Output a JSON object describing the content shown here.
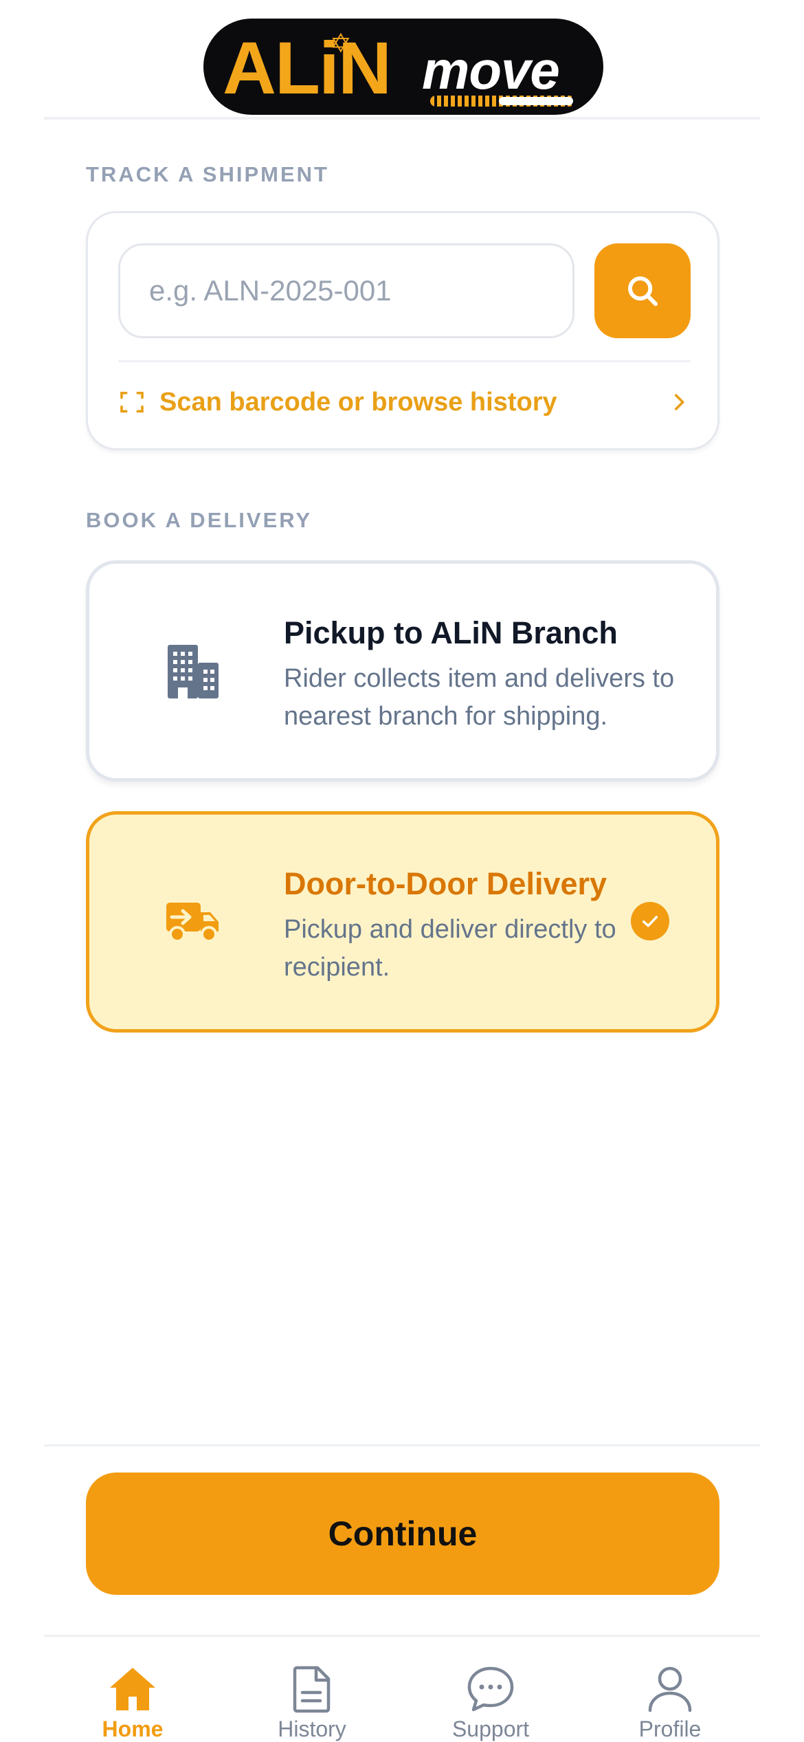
{
  "brand": {
    "logo_main": "ALiN",
    "logo_sub": "move"
  },
  "colors": {
    "accent": "#f39c12",
    "accent_text": "#e9a017",
    "selected_bg": "#fef3c7",
    "muted_label": "#94a0b4",
    "nav_inactive": "#7c8696"
  },
  "track": {
    "section_label": "TRACK A SHIPMENT",
    "input_value": "",
    "input_placeholder": "e.g. ALN-2025-001",
    "search_icon": "search-icon",
    "scan_label": "Scan barcode or browse history"
  },
  "book": {
    "section_label": "BOOK A DELIVERY",
    "options": [
      {
        "title": "Pickup to ALiN Branch",
        "description": "Rider collects item and delivers to nearest branch for shipping.",
        "icon": "building-icon",
        "selected": false
      },
      {
        "title": "Door-to-Door Delivery",
        "description": "Pickup and deliver directly to recipient.",
        "icon": "truck-icon",
        "selected": true
      }
    ]
  },
  "continue_label": "Continue",
  "nav": {
    "items": [
      {
        "label": "Home",
        "icon": "home-icon",
        "active": true
      },
      {
        "label": "History",
        "icon": "document-icon",
        "active": false
      },
      {
        "label": "Support",
        "icon": "chat-icon",
        "active": false
      },
      {
        "label": "Profile",
        "icon": "user-icon",
        "active": false
      }
    ]
  }
}
